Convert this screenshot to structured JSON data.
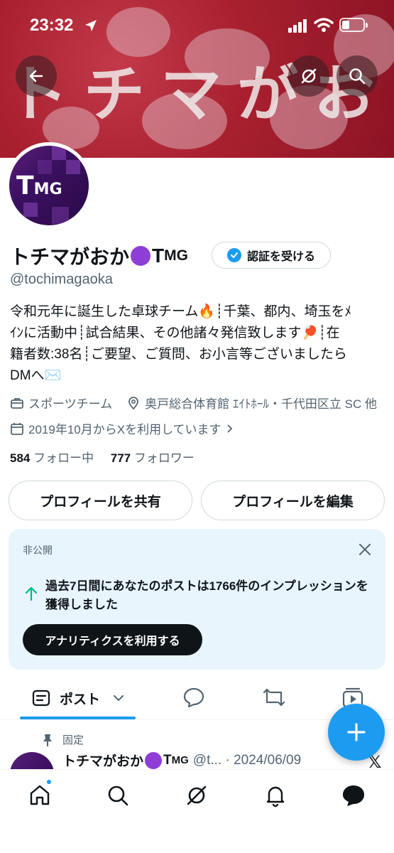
{
  "status_bar": {
    "time": "23:32"
  },
  "banner": {
    "calligraphy": "トチマがおか"
  },
  "profile": {
    "name_prefix": "トチマがおか",
    "name_suffix_big": "T",
    "name_suffix_small": "MG",
    "avatar_text_big": "T",
    "avatar_text_small": "MG",
    "verify_button": "認証を受ける",
    "handle": "@tochimagaoka",
    "bio_lines": [
      "令和元年に誕生した卓球チーム🔥┊千葉、都内、埼玉をﾒ",
      "ｲﾝに活動中┊試合結果、その他諸々発信致します🏓┊在",
      "籍者数:38名┊ご要望、ご質問、お小言等ございましたら",
      "DMへ✉️"
    ],
    "category": "スポーツチーム",
    "location": "奥戸総合体育館 ｴｲﾄﾎｰﾙ・千代田区立 SC 他",
    "joined": "2019年10月からXを利用しています",
    "following_count": "584",
    "following_label": "フォロー中",
    "followers_count": "777",
    "followers_label": "フォロワー"
  },
  "buttons": {
    "share_profile": "プロフィールを共有",
    "edit_profile": "プロフィールを編集"
  },
  "private_card": {
    "label": "非公開",
    "message": "過去7日間にあなたのポストは1766件のインプレッションを獲得しました",
    "cta": "アナリティクスを利用する"
  },
  "tabs": {
    "posts": "ポスト"
  },
  "pinned_post": {
    "pinned_label": "固定",
    "author_prefix": "トチマがおか",
    "author_suffix_big": "T",
    "author_suffix_small": "MG",
    "handle_date": "@t... · 2024/06/09"
  },
  "colors": {
    "accent": "#1d9bf0",
    "banner": "#a8202f",
    "text_secondary": "#536471"
  }
}
